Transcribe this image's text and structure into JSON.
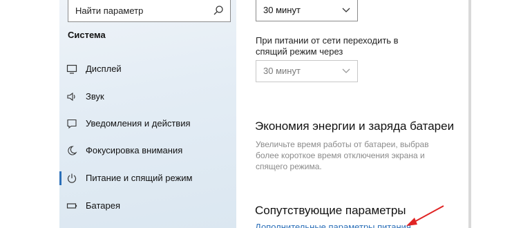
{
  "search": {
    "placeholder": "Найти параметр"
  },
  "sidebar": {
    "section_title": "Система",
    "items": [
      {
        "label": "Дисплей",
        "icon": "display-icon"
      },
      {
        "label": "Звук",
        "icon": "speaker-icon"
      },
      {
        "label": "Уведомления и действия",
        "icon": "notification-icon"
      },
      {
        "label": "Фокусировка внимания",
        "icon": "moon-icon"
      },
      {
        "label": "Питание и спящий режим",
        "icon": "power-icon",
        "active": true
      },
      {
        "label": "Батарея",
        "icon": "battery-icon"
      }
    ]
  },
  "main": {
    "screen_select_value": "30 минут",
    "sleep_label": "При питании от сети переходить в спящий режим через",
    "sleep_select_value": "30 минут",
    "battery_heading": "Экономия энергии и заряда батареи",
    "battery_desc": "Увеличьте время работы от батареи, выбрав более короткое время отключения экрана и спящего режима.",
    "related_heading": "Сопутствующие параметры",
    "related_link": "Дополнительные параметры питания"
  },
  "colors": {
    "accent": "#2b6fb8",
    "annotation_arrow": "#e02424"
  }
}
